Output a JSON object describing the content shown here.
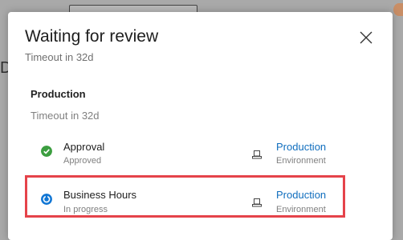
{
  "background": {
    "letter": "D"
  },
  "dialog": {
    "title": "Waiting for review",
    "subtitle": "Timeout in 32d",
    "close_icon": "close-icon"
  },
  "stage": {
    "name": "Production",
    "timeout": "Timeout in 32d"
  },
  "checks": [
    {
      "name": "Approval",
      "status": "Approved",
      "status_icon": "success-check-icon",
      "status_color": "#3c9e40",
      "environment": "Production",
      "environment_type": "Environment"
    },
    {
      "name": "Business Hours",
      "status": "In progress",
      "status_icon": "in-progress-icon",
      "status_color": "#1176d4",
      "environment": "Production",
      "environment_type": "Environment",
      "highlighted": true,
      "highlight_color": "#e5434a"
    }
  ]
}
